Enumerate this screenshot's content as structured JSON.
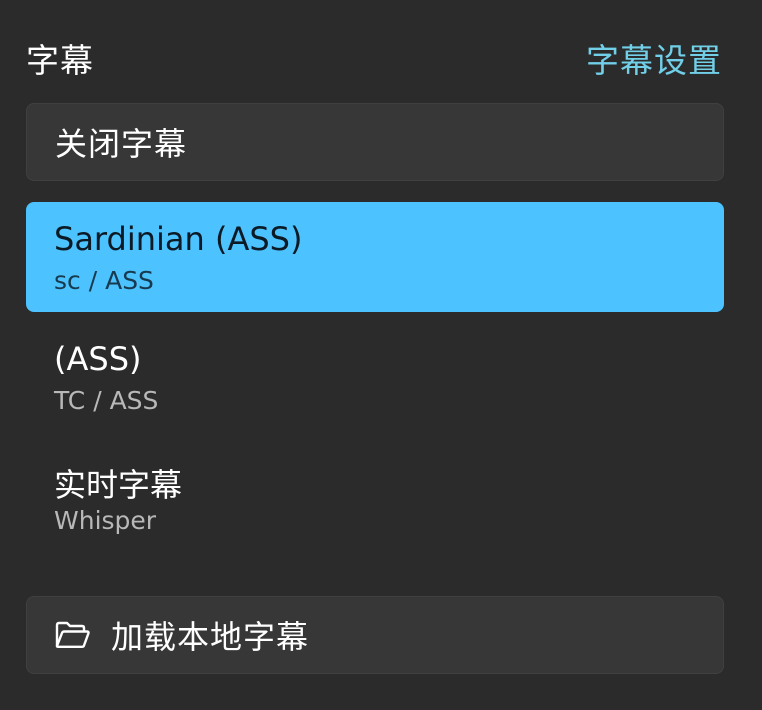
{
  "header": {
    "title": "字幕",
    "settings_link": "字幕设置"
  },
  "off_button": {
    "label": "关闭字幕"
  },
  "tracks": [
    {
      "title": "Sardinian (ASS)",
      "subtitle": "sc / ASS",
      "selected": true
    },
    {
      "title": "(ASS)",
      "subtitle": "TC / ASS",
      "selected": false
    },
    {
      "title": "实时字幕",
      "subtitle": "Whisper",
      "selected": false
    }
  ],
  "load_button": {
    "icon": "folder-open-icon",
    "label": "加载本地字幕"
  },
  "colors": {
    "background": "#2b2b2b",
    "accent": "#4cc2ff",
    "link": "#71cfe8",
    "button": "#373737"
  }
}
